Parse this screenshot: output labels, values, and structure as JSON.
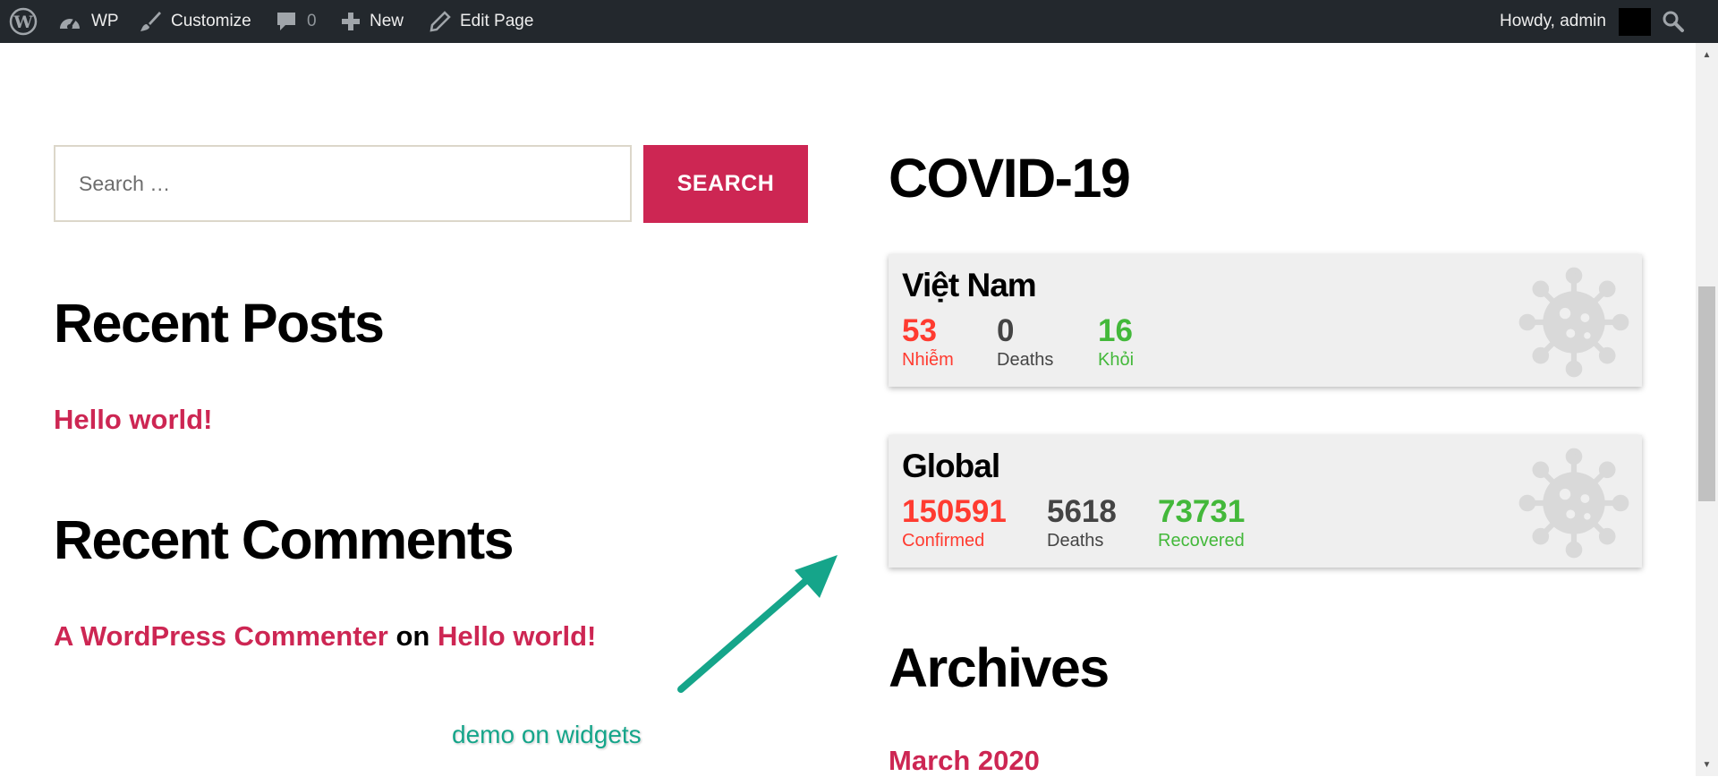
{
  "admin_bar": {
    "site_name": "WP",
    "customize": "Customize",
    "comments_count": "0",
    "new": "New",
    "edit_page": "Edit Page",
    "howdy": "Howdy, admin"
  },
  "search": {
    "placeholder": "Search …",
    "button": "SEARCH"
  },
  "recent_posts": {
    "title": "Recent Posts",
    "items": [
      "Hello world!"
    ]
  },
  "recent_comments": {
    "title": "Recent Comments",
    "author": "A WordPress Commenter",
    "on": "on",
    "post": "Hello world!"
  },
  "covid": {
    "title": "COVID-19",
    "vietnam": {
      "name": "Việt Nam",
      "infected": "53",
      "infected_label": "Nhiễm",
      "deaths": "0",
      "deaths_label": "Deaths",
      "recovered": "16",
      "recovered_label": "Khỏi"
    },
    "global": {
      "name": "Global",
      "confirmed": "150591",
      "confirmed_label": "Confirmed",
      "deaths": "5618",
      "deaths_label": "Deaths",
      "recovered": "73731",
      "recovered_label": "Recovered"
    }
  },
  "archives": {
    "title": "Archives",
    "items": [
      "March 2020"
    ]
  },
  "annotation": "demo on widgets",
  "colors": {
    "admin_bar_bg": "#23282d",
    "accent": "#cd2653",
    "confirmed": "#ff3b30",
    "recovered": "#43b83a",
    "annotation_arrow": "#15a58a"
  }
}
